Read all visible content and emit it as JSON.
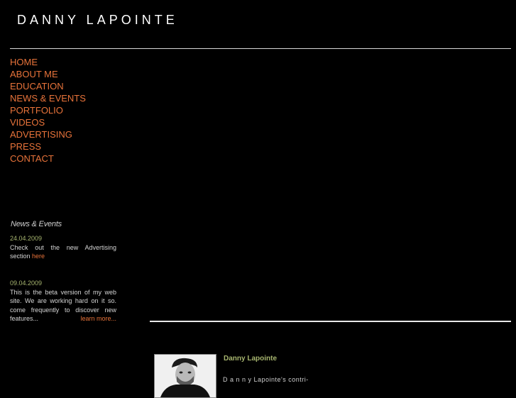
{
  "header": {
    "title": "DANNY LAPOINTE"
  },
  "nav": {
    "items": [
      {
        "label": "HOME"
      },
      {
        "label": "ABOUT ME"
      },
      {
        "label": "EDUCATION"
      },
      {
        "label": "NEWS & EVENTS"
      },
      {
        "label": "PORTFOLIO"
      },
      {
        "label": "VIDEOS"
      },
      {
        "label": "ADVERTISING"
      },
      {
        "label": "PRESS"
      },
      {
        "label": "CONTACT"
      }
    ]
  },
  "news": {
    "heading": "News & Events",
    "entries": [
      {
        "date": "24.04.2009",
        "text": "Check out the new Advertising section ",
        "link": "here"
      },
      {
        "date": "09.04.2009",
        "text": "This is the beta version of my web site. We are working hard on it so. come frequently to discover new features...",
        "link": "learn more..."
      }
    ]
  },
  "profile": {
    "name": "Danny Lapointe",
    "bio": "D a n n y Lapointe's       contri-"
  },
  "colors": {
    "accent": "#e8733a",
    "date": "#a7b56f",
    "background": "#000000"
  }
}
